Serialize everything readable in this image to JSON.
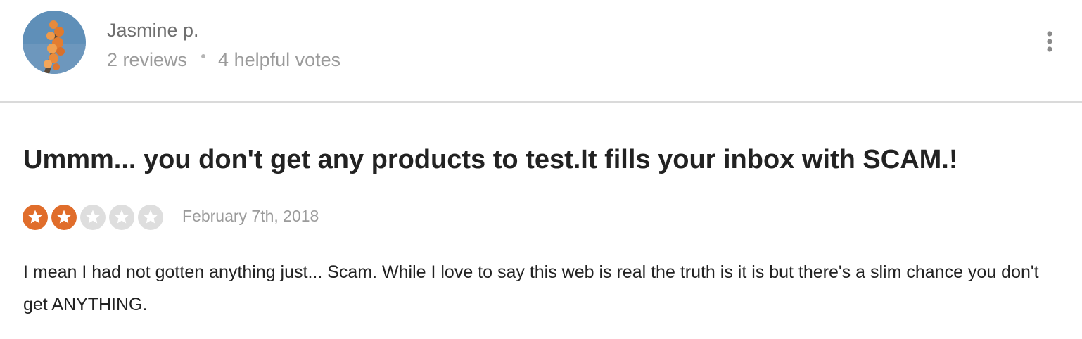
{
  "reviewer": {
    "name": "Jasmine p.",
    "reviews": "2 reviews",
    "helpful_votes": "4 helpful votes"
  },
  "review": {
    "title": "Ummm... you don't get any products to test.It fills your inbox with SCAM.!",
    "rating": 2,
    "rating_max": 5,
    "date": "February 7th, 2018",
    "body": "I mean I had not gotten anything just... Scam. While I love to say this web is real the truth is it is but there's a slim chance you don't get ANYTHING."
  },
  "icons": {
    "more": "more-vertical-icon",
    "star": "star-icon"
  },
  "colors": {
    "star_filled": "#e06d2b",
    "star_empty": "#dedede",
    "divider": "#dadada",
    "title_text": "#222222",
    "muted_text": "#9b9b9b"
  }
}
